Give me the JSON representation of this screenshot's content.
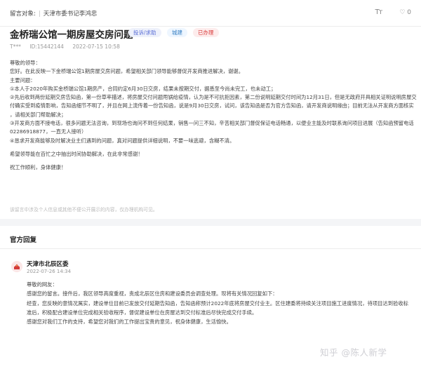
{
  "topbar": {
    "target_label": "留言对象:",
    "target_value": "天津市委书记李鸿忠",
    "font_icon": "Tт",
    "like_count": "0"
  },
  "post": {
    "title": "金桥瑞公馆一期房屋交房问题",
    "tags": {
      "type": "投诉/求助",
      "dept": "城建",
      "status": "已办理"
    },
    "author": "T***",
    "id": "ID:15442144",
    "datetime": "2022-07-15 10:58",
    "body": [
      "尊敬的领导：",
      "您好。在此反映一下金桥瑞公馆1期房屋交房问题，希望相关部门领导能够督促开发商推进解决，谢谢。",
      "主要问题：",
      "①本人于2020年购买金桥瑞公馆1期房产，合同约定6月30日交房，结果未按期交付，据悉至今尚未完工，也未动工；",
      "②先后收到两份延期交房告知函，第一份草率描述，将房屋交付问题甩锅给疫情，认为是不可抗拒因素，第二份说明延期交付时间为12月31日，但是无政府开具相关证明说明房屋交",
      "付确实受到疫情影响，告知函细节不明了，并且在网上流传着一份告知函，说是9月30日交房，试问，该告知函是否为官方告知函，请开发商说明缘由；目前无法从开发商方面核实",
      "，请相关部门帮助解决；",
      "③开发商方面不接电话，很多问题无法咨询，到现场也询问不到任何结果，销售一问三不知，辛苦相关部门督促保证电话畅通，以便业主能及时联系询问项目进展（告知函预留电话",
      "02286918877，一直无人接听）",
      "④恳求开发商能够及时解决业主们遇到的问题，真对问题提供详细说明，不要一味逃避，含糊不清。",
      "希望领导能在百忙之中抽出时间协助解决，在此非常感谢！",
      "祝工作顺利，身体健康！"
    ],
    "disclaimer": "该留言中涉及个人信息或其他不便公开展示的内容，仅办理机构可见。"
  },
  "reply": {
    "heading": "官方回复",
    "org": "天津市北辰区委",
    "datetime": "2022-07-26 14:34",
    "body": [
      "尊敬的网友：",
      "    感谢您的留言。接件后，我区领导高度重视，责成北辰区住房和建设委员会调查处理。现将有关情况回复如下：",
      "    经查，您反映的意情况属实，建设单位目前已发放交付延期告知函，告知函称预计2022年底将房屋交付业主。区住建委将持续关注项目施工进度情况，待项目达到验收标",
      "准后，积极配合建设单位完成相关验收程序，督促建设单位在房屋达到交付标准后尽快完成交付手续。",
      "    感谢您对我们工作的支持，希望您对我们的工作提出宝贵的意见，祝身体健康，生活愉快。"
    ]
  },
  "watermark": "知乎 @陈人新学",
  "colors": {
    "tag_type": "#5b6fd6",
    "tag_dept": "#3b82c4",
    "tag_status": "#d93b3b",
    "avatar_emblem": "#d33a3a"
  }
}
